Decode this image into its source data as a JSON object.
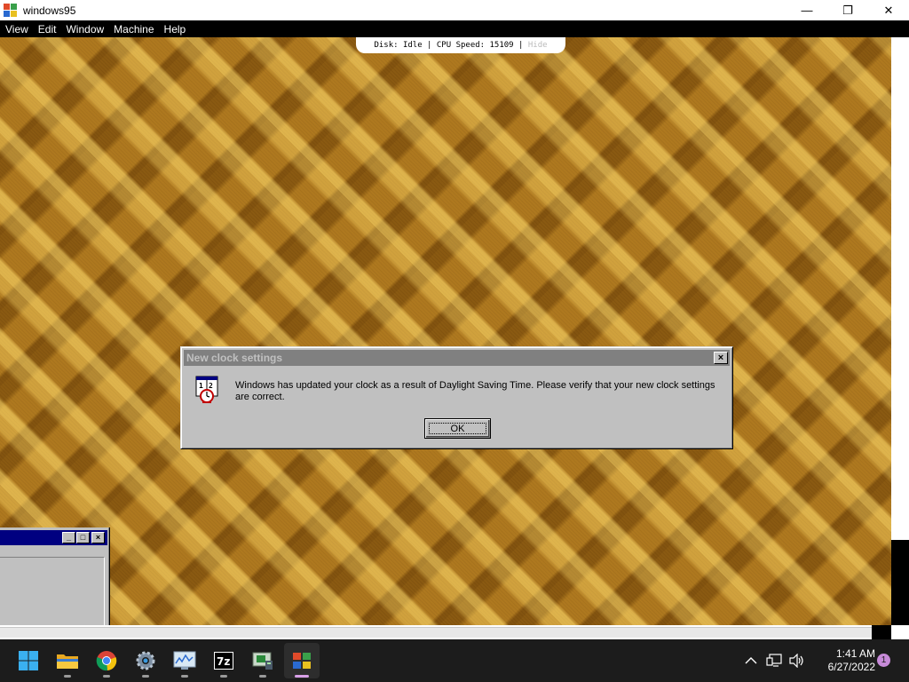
{
  "host_window": {
    "title": "windows95",
    "controls": {
      "minimize": "—",
      "maximize": "❐",
      "close": "✕"
    }
  },
  "menubar": {
    "items": [
      "View",
      "Edit",
      "Window",
      "Machine",
      "Help"
    ]
  },
  "status_bar": {
    "disk_label": "Disk: Idle",
    "separator": "|",
    "cpu_label": "CPU Speed: 15109",
    "hide_label": "Hide"
  },
  "dialog": {
    "title": "New clock settings",
    "message": "Windows has updated your clock as a result of Daylight Saving Time.  Please verify that your new clock settings are correct.",
    "ok_label": "OK",
    "icon": "clock-settings-icon",
    "close_glyph": "×"
  },
  "mini_window": {
    "titlebar_color": "#000080",
    "buttons": {
      "minimize": "_",
      "maximize": "□",
      "close": "×"
    }
  },
  "taskbar": {
    "apps": [
      {
        "name": "start-button",
        "icon": "windows-logo-icon",
        "active": false,
        "running": false
      },
      {
        "name": "file-explorer",
        "icon": "folder-icon",
        "active": false,
        "running": true
      },
      {
        "name": "chrome",
        "icon": "chrome-icon",
        "active": false,
        "running": true
      },
      {
        "name": "settings",
        "icon": "gear-icon",
        "active": false,
        "running": true
      },
      {
        "name": "resource-monitor",
        "icon": "monitor-graph-icon",
        "active": false,
        "running": true
      },
      {
        "name": "7zip",
        "icon": "7zip-icon",
        "active": false,
        "running": true
      },
      {
        "name": "cpu-tool",
        "icon": "chip-icon",
        "active": false,
        "running": true
      },
      {
        "name": "windows95-app",
        "icon": "windows95-icon",
        "active": true,
        "running": true
      }
    ],
    "tray": {
      "chevron": "^",
      "time": "1:41 AM",
      "date": "6/27/2022",
      "notifications": "1"
    }
  },
  "colors": {
    "desktop_base": "#a8741a",
    "dialog_face": "#c0c0c0",
    "inactive_title": "#808080",
    "taskbar": "#1c1c1c",
    "accent_indicator": "#d8a0e8"
  }
}
